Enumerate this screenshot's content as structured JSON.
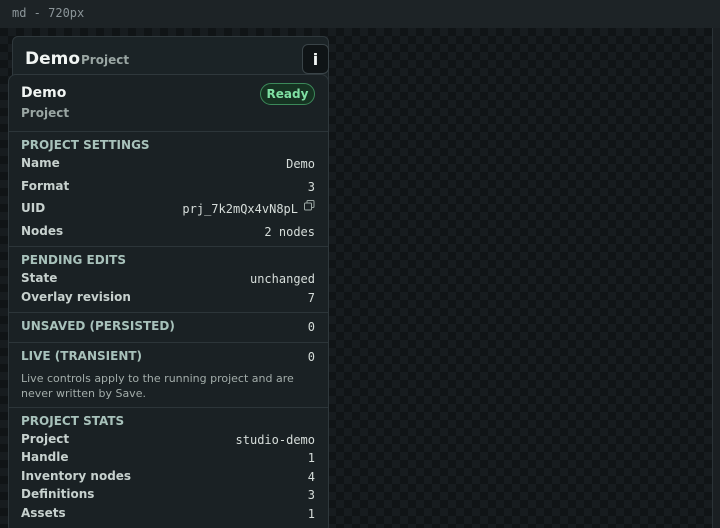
{
  "viewport": {
    "label": "md - 720px"
  },
  "header": {
    "title": "Demo",
    "subtitle": "Project",
    "info_label": "i"
  },
  "panel": {
    "title": "Demo",
    "subtitle": "Project",
    "status_badge": "Ready",
    "project_settings": {
      "heading": "PROJECT SETTINGS",
      "rows": [
        {
          "label": "Name",
          "value": "Demo"
        },
        {
          "label": "Format",
          "value": "3"
        },
        {
          "label": "UID",
          "value": "prj_7k2mQx4vN8pL"
        },
        {
          "label": "Nodes",
          "value": "2 nodes"
        }
      ]
    },
    "pending_edits": {
      "heading": "PENDING EDITS",
      "rows": [
        {
          "label": "State",
          "value": "unchanged"
        },
        {
          "label": "Overlay revision",
          "value": "7"
        }
      ]
    },
    "unsaved": {
      "heading": "UNSAVED (PERSISTED)",
      "value": "0"
    },
    "live": {
      "heading": "LIVE (TRANSIENT)",
      "value": "0",
      "note": "Live controls apply to the running project and are never written by Save."
    },
    "project_stats": {
      "heading": "PROJECT STATS",
      "rows": [
        {
          "label": "Project",
          "value": "studio-demo"
        },
        {
          "label": "Handle",
          "value": "1"
        },
        {
          "label": "Inventory nodes",
          "value": "4"
        },
        {
          "label": "Definitions",
          "value": "3"
        },
        {
          "label": "Assets",
          "value": "1"
        }
      ]
    }
  },
  "colors": {
    "accent_ready": "#7fe0a3",
    "section_heading": "#a8c2bb",
    "panel_bg": "#1a2124"
  }
}
